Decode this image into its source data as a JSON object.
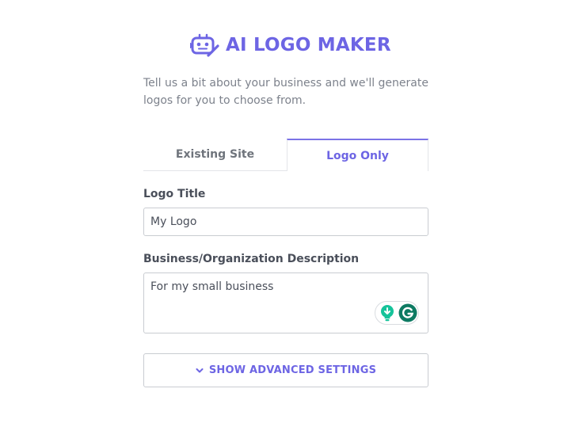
{
  "colors": {
    "accent": "#6d65e4",
    "accent_light": "#8a83ee",
    "grammarly_green": "#15c39a",
    "grammarly_dark": "#0d7a62"
  },
  "header": {
    "icon": "robot-pencil-icon",
    "title": "AI LOGO MAKER"
  },
  "intro": {
    "text": "Tell us a bit about your business and we'll generate logos for you to choose from."
  },
  "tabs": [
    {
      "label": "Existing Site",
      "active": false
    },
    {
      "label": "Logo Only",
      "active": true
    }
  ],
  "form": {
    "logo_title": {
      "label": "Logo Title",
      "value": "My Logo"
    },
    "description": {
      "label": "Business/Organization Description",
      "value": "For my small business"
    }
  },
  "grammarly": {
    "icons": [
      "lightbulb-icon",
      "grammarly-icon"
    ]
  },
  "advanced": {
    "icon": "chevron-down-icon",
    "label": "SHOW ADVANCED SETTINGS"
  }
}
